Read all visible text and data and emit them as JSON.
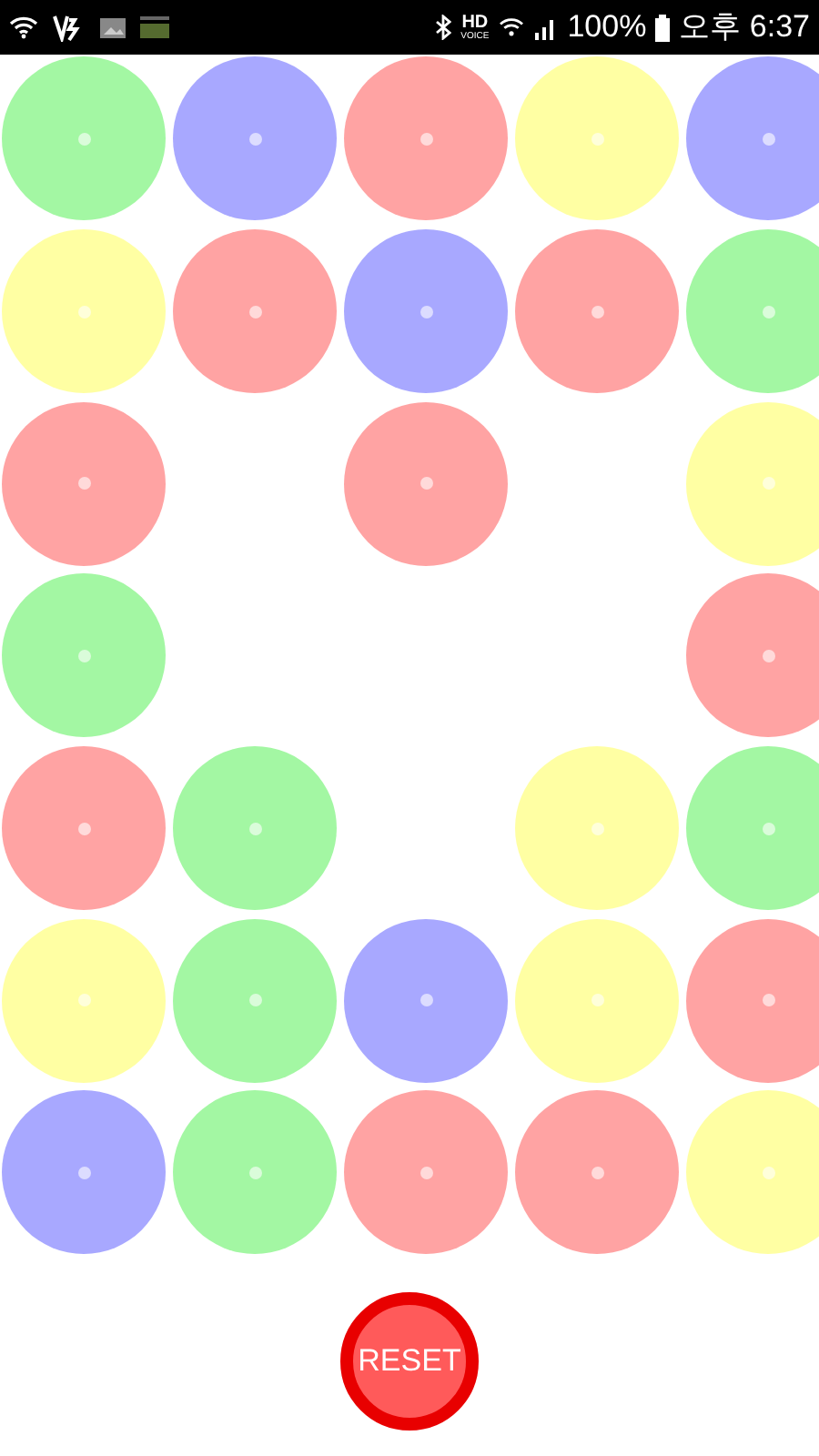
{
  "status_bar": {
    "hd": "HD",
    "voice": "VOICE",
    "battery": "100%",
    "time": "오후 6:37"
  },
  "grid": [
    [
      {
        "kind": "ball",
        "color": "#a3f7a3"
      },
      {
        "kind": "ball",
        "color": "#a8a8ff"
      },
      {
        "kind": "ball",
        "color": "#ffa3a3"
      },
      {
        "kind": "ball",
        "color": "#ffffa3"
      },
      {
        "kind": "ball",
        "color": "#a8a8ff"
      }
    ],
    [
      {
        "kind": "ball",
        "color": "#ffffa3"
      },
      {
        "kind": "ball",
        "color": "#ffa3a3"
      },
      {
        "kind": "ball",
        "color": "#a8a8ff"
      },
      {
        "kind": "ball",
        "color": "#ffa3a3"
      },
      {
        "kind": "ball",
        "color": "#a3f7a3"
      }
    ],
    [
      {
        "kind": "ball",
        "color": "#ffa3a3"
      },
      {
        "kind": "empty"
      },
      {
        "kind": "ball",
        "color": "#ffa3a3"
      },
      {
        "kind": "empty"
      },
      {
        "kind": "ball",
        "color": "#ffffa3"
      }
    ],
    [
      {
        "kind": "ball",
        "color": "#a3f7a3"
      },
      {
        "kind": "empty"
      },
      {
        "kind": "empty"
      },
      {
        "kind": "empty"
      },
      {
        "kind": "ball",
        "color": "#ffa3a3"
      }
    ],
    [
      {
        "kind": "ball",
        "color": "#ffa3a3"
      },
      {
        "kind": "ball",
        "color": "#a3f7a3"
      },
      {
        "kind": "empty"
      },
      {
        "kind": "ball",
        "color": "#ffffa3"
      },
      {
        "kind": "ball",
        "color": "#a3f7a3"
      }
    ],
    [
      {
        "kind": "ball",
        "color": "#ffffa3"
      },
      {
        "kind": "ball",
        "color": "#a3f7a3"
      },
      {
        "kind": "ball",
        "color": "#a8a8ff"
      },
      {
        "kind": "ball",
        "color": "#ffffa3"
      },
      {
        "kind": "ball",
        "color": "#ffa3a3"
      }
    ],
    [
      {
        "kind": "ball",
        "color": "#a8a8ff"
      },
      {
        "kind": "ball",
        "color": "#a3f7a3"
      },
      {
        "kind": "ball",
        "color": "#ffa3a3"
      },
      {
        "kind": "ball",
        "color": "#ffa3a3"
      },
      {
        "kind": "ball",
        "color": "#ffffa3"
      }
    ]
  ],
  "reset_button": {
    "label": "RESET"
  }
}
